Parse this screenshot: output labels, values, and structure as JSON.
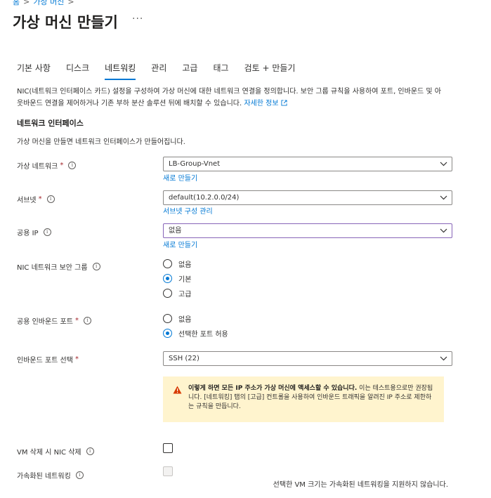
{
  "breadcrumb": {
    "home": "홈",
    "parent": "가상 머신",
    "sep": ">"
  },
  "page": {
    "title": "가상 머신 만들기",
    "more": "···"
  },
  "tabs": [
    "기본 사항",
    "디스크",
    "네트워킹",
    "관리",
    "고급",
    "태그",
    "검토 + 만들기"
  ],
  "active_tab": "네트워킹",
  "intro": {
    "text": "NIC(네트워크 인터페이스 카드) 설정을 구성하여 가상 머신에 대한 네트워크 연결을 정의합니다. 보안 그룹 규칙을 사용하여 포트, 인바운드 및 아웃바운드 연결을 제어하거나 기존 부하 분산 솔루션 뒤에 배치할 수 있습니다.",
    "link": "자세한 정보"
  },
  "section": {
    "title": "네트워크 인터페이스",
    "subtitle": "가상 머신을 만들면 네트워크 인터페이스가 만들어집니다."
  },
  "fields": {
    "vnet": {
      "label": "가상 네트워크",
      "required": "*",
      "value": "LB-Group-Vnet",
      "link": "새로 만들기"
    },
    "subnet": {
      "label": "서브넷",
      "required": "*",
      "value": "default(10.2.0.0/24)",
      "link": "서브넷 구성 관리"
    },
    "public_ip": {
      "label": "공용 IP",
      "value": "없음",
      "link": "새로 만들기"
    },
    "nsg": {
      "label": "NIC 네트워크 보안 그룹",
      "options": [
        "없음",
        "기본",
        "고급"
      ],
      "selected": "기본"
    },
    "inbound": {
      "label": "공용 인바운드 포트",
      "required": "*",
      "options": [
        "없음",
        "선택한 포트 허용"
      ],
      "selected": "선택한 포트 허용"
    },
    "inbound_select": {
      "label": "인바운드 포트 선택",
      "required": "*",
      "value": "SSH (22)"
    },
    "delete_nic": {
      "label": "VM 삭제 시 NIC 삭제",
      "checked": false
    },
    "accel": {
      "label": "가속화된 네트워킹",
      "checked": false,
      "disabled": true,
      "note": "선택한 VM 크기는 가속화된 네트워킹을 지원하지 않습니다."
    }
  },
  "warning": {
    "bold": "이렇게 하면 모든 IP 주소가 가상 머신에 액세스할 수 있습니다.",
    "text": " 이는 테스트용으로만 권장됩니다. [네트워킹] 탭의 [고급] 컨트롤을 사용하여 인바운드 트래픽을 알려진 IP 주소로 제한하는 규칙을 만듭니다."
  },
  "colors": {
    "accent": "#0078d4",
    "warning_bg": "#fff4ce",
    "warning_icon": "#d83b01",
    "required": "#a4262c"
  },
  "icons": {
    "info": "info-icon",
    "chevron": "chevron-down-icon",
    "external": "external-link-icon",
    "warning": "warning-icon"
  }
}
